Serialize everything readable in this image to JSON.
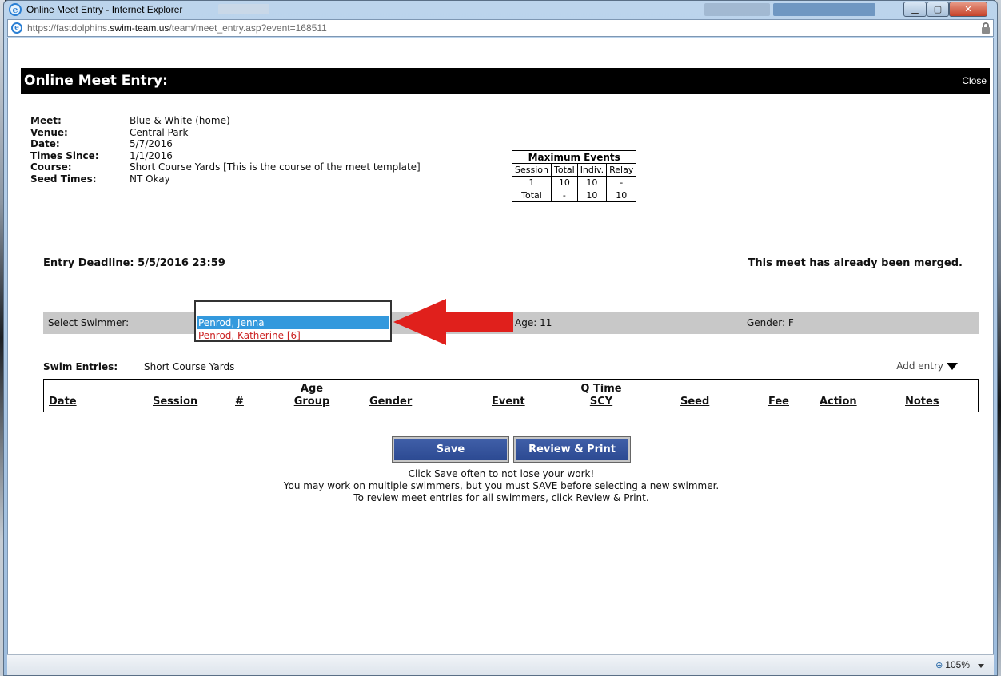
{
  "window": {
    "title": "Online Meet Entry - Internet Explorer"
  },
  "address": {
    "url_prefix": "https://fastdolphins.",
    "url_domain": "swim-team.us",
    "url_suffix": "/team/meet_entry.asp?event=168511"
  },
  "page": {
    "title": "Online Meet Entry:",
    "close_label": "Close"
  },
  "meet_info": [
    {
      "label": "Meet:",
      "value": "Blue & White (home)"
    },
    {
      "label": "Venue:",
      "value": "Central Park"
    },
    {
      "label": "Date:",
      "value": "5/7/2016"
    },
    {
      "label": "Times Since:",
      "value": "1/1/2016"
    },
    {
      "label": "Course:",
      "value": "Short Course Yards [This is the course of the meet template]"
    },
    {
      "label": "Seed Times:",
      "value": "NT Okay"
    }
  ],
  "max_events": {
    "caption": "Maximum Events",
    "headers": [
      "Session",
      "Total",
      "Indiv.",
      "Relay"
    ],
    "rows": [
      [
        "1",
        "10",
        "10",
        "-"
      ],
      [
        "Total",
        "-",
        "10",
        "10"
      ]
    ]
  },
  "deadline_text": "Entry Deadline: 5/5/2016 23:59",
  "merged_text": "This meet has already been merged.",
  "swimmer": {
    "label": "Select Swimmer:",
    "options": [
      "Penrod, Jenna",
      "Penrod, Katherine [6]"
    ],
    "selected": "Penrod, Jenna",
    "age_text": "Age: 11",
    "gender_text": "Gender: F"
  },
  "entries": {
    "label": "Swim Entries:",
    "course": "Short Course Yards",
    "add_entry_label": "Add entry",
    "columns": {
      "date": "Date",
      "session": "Session",
      "num": "#",
      "age_top": "Age",
      "age_bottom": "Group",
      "gender": "Gender",
      "event": "Event",
      "qtime_top": "Q Time",
      "qtime_bottom": "SCY",
      "seed": "Seed",
      "fee": "Fee",
      "action": "Action",
      "notes": "Notes"
    }
  },
  "buttons": {
    "save": "Save",
    "review": "Review & Print"
  },
  "help": [
    "Click Save often to not lose your work!",
    "You may work on multiple swimmers, but you must SAVE before selecting a new swimmer.",
    "To review meet entries for all swimmers, click Review & Print."
  ],
  "status": {
    "zoom": "105%",
    "zoom_icon": "magnifier-icon"
  },
  "colors": {
    "header_bg": "#000000",
    "button_bg": "#2c4a92",
    "selected_option": "#3399dd",
    "alt_option_text": "#cc2222",
    "arrow": "#e0201c"
  }
}
